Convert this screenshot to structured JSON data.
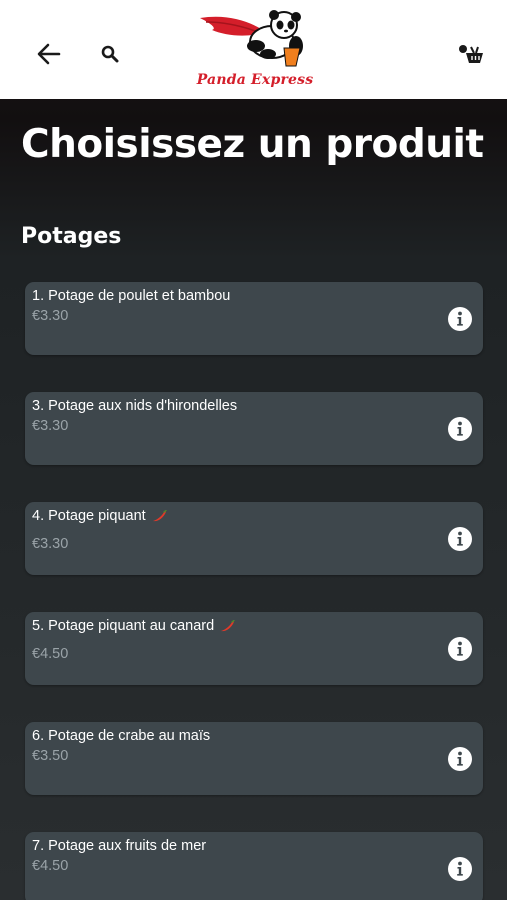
{
  "brand": {
    "name": "Panda Express",
    "accent": "#d41e2a"
  },
  "header": {
    "back_icon": "arrow-left-icon",
    "search_icon": "search-icon",
    "cart_icon": "cart-icon"
  },
  "page_title": "Choisissez un produit",
  "section": {
    "title": "Potages",
    "products": [
      {
        "name": "1. Potage de poulet et bambou",
        "price": "€3.30",
        "spicy": false
      },
      {
        "name": "3. Potage aux nids d'hirondelles",
        "price": "€3.30",
        "spicy": false
      },
      {
        "name": "4. Potage piquant",
        "price": "€3.30",
        "spicy": true
      },
      {
        "name": "5. Potage piquant au canard",
        "price": "€4.50",
        "spicy": true
      },
      {
        "name": "6. Potage de crabe au maïs",
        "price": "€3.50",
        "spicy": false
      },
      {
        "name": "7. Potage aux fruits de mer",
        "price": "€4.50",
        "spicy": false
      }
    ]
  },
  "colors": {
    "card": "#3e474c",
    "price": "#9aa3a8",
    "background": "#1b1718"
  }
}
